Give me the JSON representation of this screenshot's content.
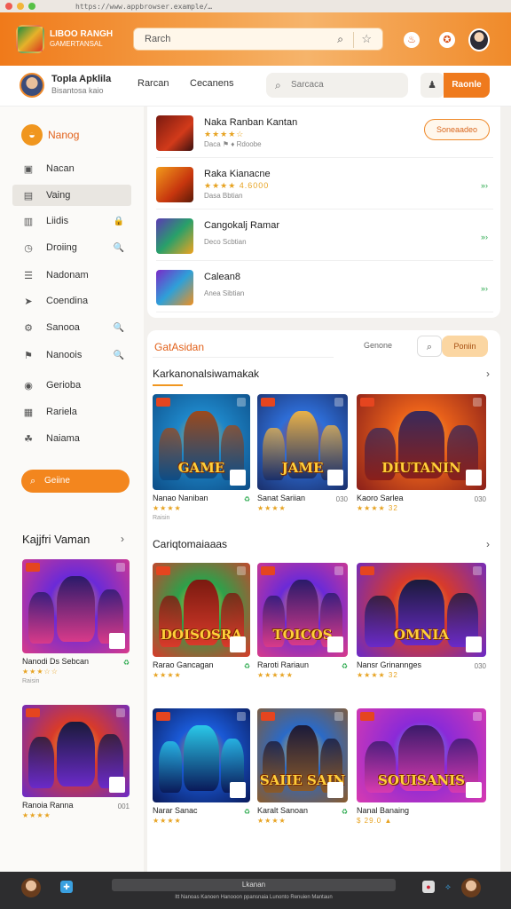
{
  "browser": {
    "url": "https://www.appbrowser.example/…"
  },
  "topbar": {
    "brand_line1": "LIBOO RANGH",
    "brand_line2": "GAMERTANSAL",
    "search_placeholder": "Rarch",
    "icons": [
      "search-icon",
      "star-icon",
      "fire-icon",
      "badge-icon"
    ]
  },
  "subheader": {
    "user_name": "Topla Apklila",
    "user_sub": "Bisantosa kaio",
    "nav": [
      "Rarcan",
      "Cecanens"
    ],
    "search_placeholder": "Sarcaca",
    "button": "Raonle"
  },
  "sidebar": {
    "header": "Nanog",
    "items": [
      {
        "label": "Nacan",
        "icon": "home-icon",
        "glyph": "▣",
        "right": ""
      },
      {
        "label": "Vaing",
        "icon": "video-icon",
        "glyph": "▤",
        "right": "",
        "active": true
      },
      {
        "label": "Liidis",
        "icon": "list-icon",
        "glyph": "▥",
        "right": "🔒"
      },
      {
        "label": "Droiing",
        "icon": "clock-icon",
        "glyph": "◷",
        "right": "🔍"
      },
      {
        "label": "Nadonam",
        "icon": "menu-icon",
        "glyph": "☰",
        "right": ""
      },
      {
        "label": "Coendina",
        "icon": "cursor-icon",
        "glyph": "➤",
        "right": ""
      },
      {
        "label": "Sanooa",
        "icon": "settings-icon",
        "glyph": "⚙",
        "right": "🔍"
      },
      {
        "label": "Nanoois",
        "icon": "flag-icon",
        "glyph": "⚑",
        "right": "🔍"
      },
      {
        "label": "Gerioba",
        "icon": "circle-icon",
        "glyph": "◉",
        "right": ""
      },
      {
        "label": "Rariela",
        "icon": "image-icon",
        "glyph": "▦",
        "right": ""
      },
      {
        "label": "Naiama",
        "icon": "people-icon",
        "glyph": "☘",
        "right": ""
      }
    ],
    "button": "Geiine"
  },
  "left_section": {
    "title": "Kajjfri Vaman",
    "cards": [
      {
        "title": "Nanodi Ds Sebcan",
        "num": "♻",
        "stars": "★★★☆☆",
        "sub": "Raisin"
      },
      {
        "title": "Ranoia Ranna",
        "num": "001",
        "stars": "★★★★",
        "sub": ""
      }
    ]
  },
  "list": [
    {
      "title": "Naka Ranban Kantan",
      "stars": "★★★★☆",
      "sub": "Daca ⚑ ♦ Rdoobe",
      "action": "Soneaadeo"
    },
    {
      "title": "Raka Kianacne",
      "stars": "★★★★ 4.6000",
      "sub": "Dasa Bbtian",
      "action": "»›"
    },
    {
      "title": "Cangokalj Ramar",
      "stars": "",
      "sub": "Deco Scbtian",
      "action": "»›"
    },
    {
      "title": "Calean8",
      "stars": "",
      "sub": "Anea Sibtian",
      "action": "»›"
    }
  ],
  "main": {
    "title": "GatAsidan",
    "link": "Genone",
    "button": "Poniin",
    "sections": [
      {
        "title": "Karkanonalsiwamakak",
        "cards": [
          {
            "title": "Nanao Naniban",
            "num": "♻",
            "stars": "★★★★",
            "sub": "Raisin",
            "art": "GAME"
          },
          {
            "title": "Sanat Sariian",
            "num": "030",
            "stars": "★★★★",
            "sub": "",
            "art": "JAME"
          },
          {
            "title": "Kaoro Sarlea",
            "num": "030",
            "stars": "★★★★ 32",
            "sub": "",
            "art": "DIUTANIN"
          }
        ]
      },
      {
        "title": "Cariqtomaiaaas",
        "cards": [
          {
            "title": "Rarao Gancagan",
            "num": "♻",
            "stars": "★★★★",
            "sub": "",
            "art": "DOISOSRA"
          },
          {
            "title": "Raroti Rariaun",
            "num": "♻",
            "stars": "★★★★★",
            "sub": "",
            "art": "TOICOS"
          },
          {
            "title": "Nansr Grinannges",
            "num": "030",
            "stars": "★★★★ 32",
            "sub": "",
            "art": "OMNIA"
          }
        ]
      },
      {
        "title": "",
        "cards": [
          {
            "title": "Narar Sanac",
            "num": "♻",
            "stars": "★★★★",
            "sub": "",
            "art": ""
          },
          {
            "title": "Karalt Sanoan",
            "num": "♻",
            "stars": "★★★★",
            "sub": "",
            "art": "SAIIE SAIN"
          },
          {
            "title": "Nanal Banaing",
            "num": "",
            "stars": "$ 29.0 ▲",
            "sub": "",
            "art": "SOUISANIS"
          }
        ]
      }
    ]
  },
  "taskbar": {
    "input": "Lkanan",
    "footer": "Itt Nanoas Kanoen Hanooon ppansnaia Lunonto Renuien Mantaun"
  }
}
